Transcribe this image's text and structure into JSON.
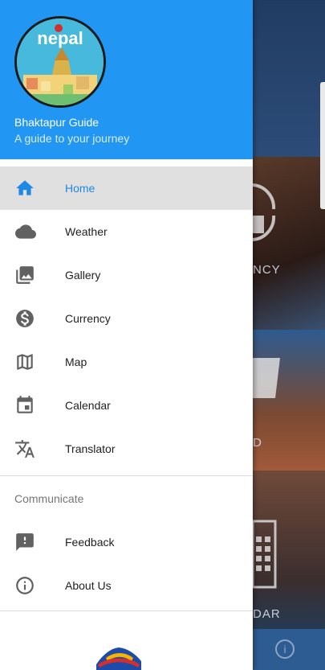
{
  "drawer": {
    "header": {
      "logo_text": "nepal",
      "title": "Bhaktapur Guide",
      "subtitle": "A guide to your journey"
    },
    "items": [
      {
        "label": "Home",
        "icon": "home-icon",
        "active": true
      },
      {
        "label": "Weather",
        "icon": "cloud-icon"
      },
      {
        "label": "Gallery",
        "icon": "gallery-icon"
      },
      {
        "label": "Currency",
        "icon": "dollar-icon"
      },
      {
        "label": "Map",
        "icon": "map-icon"
      },
      {
        "label": "Calendar",
        "icon": "calendar-icon"
      },
      {
        "label": "Translator",
        "icon": "translate-icon"
      }
    ],
    "section_label": "Communicate",
    "communicate_items": [
      {
        "label": "Feedback",
        "icon": "feedback-icon"
      },
      {
        "label": "About Us",
        "icon": "info-icon"
      }
    ]
  },
  "background": {
    "tile_labels": [
      "NCY",
      "D",
      "DAR"
    ]
  },
  "colors": {
    "primary": "#2196f3",
    "active_text": "#1e88e5",
    "active_bg": "#e0e0e0",
    "icon": "#616161"
  }
}
